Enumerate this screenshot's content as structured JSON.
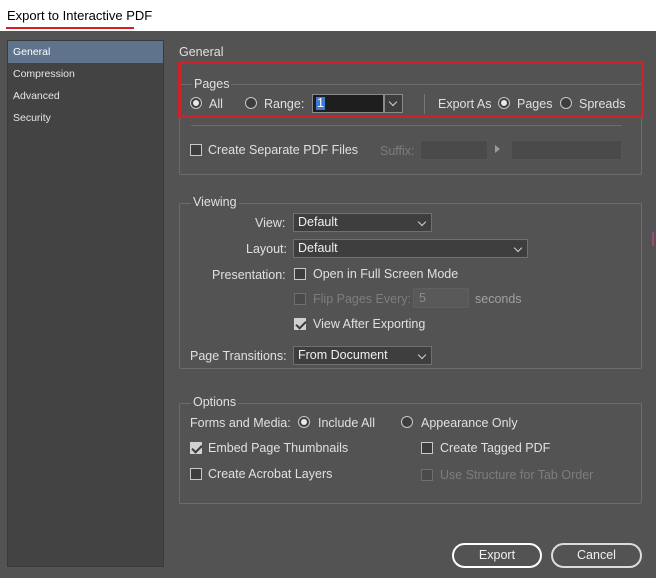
{
  "window": {
    "title": "Export to Interactive PDF"
  },
  "sidebar": {
    "items": [
      {
        "label": "General"
      },
      {
        "label": "Compression"
      },
      {
        "label": "Advanced"
      },
      {
        "label": "Security"
      }
    ]
  },
  "general": {
    "title": "General",
    "pages": {
      "legend": "Pages",
      "all_label": "All",
      "range_label": "Range:",
      "range_value": "1",
      "export_as_label": "Export As",
      "pages_option": "Pages",
      "spreads_option": "Spreads",
      "separate_label": "Create Separate PDF Files",
      "suffix_label": "Suffix:"
    }
  },
  "viewing": {
    "legend": "Viewing",
    "view_label": "View:",
    "view_value": "Default",
    "layout_label": "Layout:",
    "layout_value": "Default",
    "presentation_label": "Presentation:",
    "fullscreen_label": "Open in Full Screen Mode",
    "flip_label": "Flip Pages Every:",
    "flip_value": "5",
    "seconds_label": "seconds",
    "view_after_label": "View After Exporting",
    "transitions_label": "Page Transitions:",
    "transitions_value": "From Document"
  },
  "options": {
    "legend": "Options",
    "forms_label": "Forms and Media:",
    "include_all": "Include All",
    "appearance_only": "Appearance Only",
    "embed_thumbs": "Embed Page Thumbnails",
    "tagged_pdf": "Create Tagged PDF",
    "acrobat_layers": "Create Acrobat Layers",
    "structure_tab": "Use Structure for Tab Order"
  },
  "buttons": {
    "export": "Export",
    "cancel": "Cancel"
  },
  "colors": {
    "background": "#535353",
    "sidebar_active": "#5f748c",
    "highlight_box": "#d0202a",
    "title_underline": "#d61f1f"
  },
  "icons": {
    "dropdown": "chevron-down-icon",
    "suffix_arrow": "triangle-right-icon",
    "checkmark": "check-icon"
  }
}
